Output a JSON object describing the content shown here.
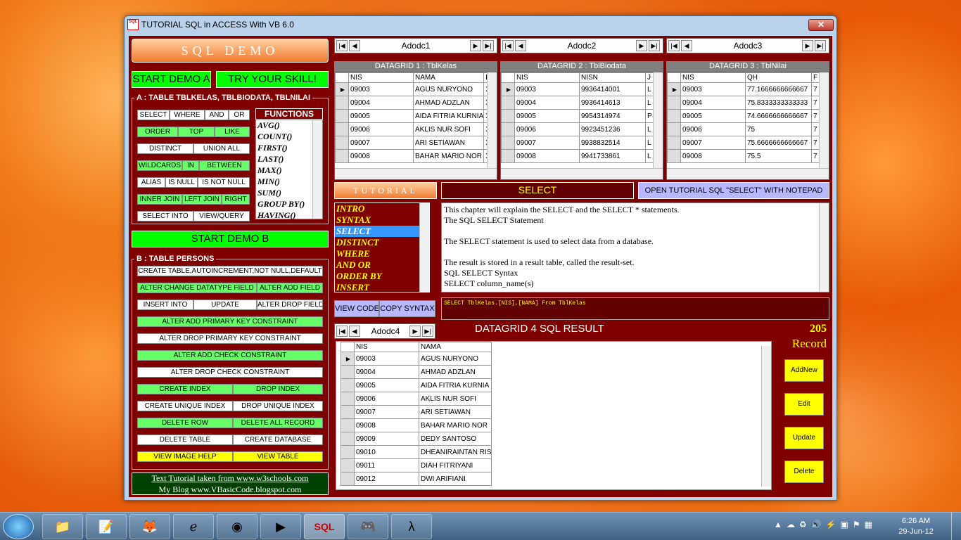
{
  "window": {
    "title": "TUTORIAL SQL in ACCESS With VB 6.0",
    "close": "✕",
    "icon_text": "SQL"
  },
  "left": {
    "banner": "SQL DEMO",
    "start_a": "START DEMO A",
    "try_skill": "TRY YOUR SKILL!",
    "section_a": "A : TABLE TBLKELAS, TBLBIODATA, TBLNILAI",
    "row1": [
      "SELECT",
      "WHERE",
      "AND",
      "OR"
    ],
    "row2": [
      "ORDER",
      "TOP",
      "LIKE"
    ],
    "row3": [
      "DISTINCT",
      "UNION ALL"
    ],
    "row4": [
      "WILDCARDS",
      "IN",
      "BETWEEN"
    ],
    "row5": [
      "ALIAS",
      "IS NULL",
      "IS NOT NULL"
    ],
    "row6": [
      "INNER JOIN",
      "LEFT JOIN",
      "RIGHT"
    ],
    "row7": [
      "SELECT INTO",
      "VIEW/QUERY"
    ],
    "functions_title": "FUNCTIONS",
    "functions": [
      "AVG()",
      "COUNT()",
      "FIRST()",
      "LAST()",
      "MAX()",
      "MIN()",
      "SUM()",
      "GROUP BY()",
      "HAVING()"
    ],
    "start_b": "START DEMO B",
    "section_b": "B : TABLE PERSONS",
    "b1": "CREATE TABLE,AUTOINCREMENT,NOT NULL,DEFAULT",
    "b2": [
      "ALTER CHANGE DATATYPE FIELD",
      "ALTER ADD FIELD"
    ],
    "b3": [
      "INSERT INTO",
      "UPDATE",
      "ALTER DROP FIELD"
    ],
    "b4": "ALTER ADD PRIMARY KEY CONSTRAINT",
    "b5": "ALTER DROP PRIMARY KEY CONSTRAINT",
    "b6": "ALTER ADD CHECK CONSTRAINT",
    "b7": "ALTER DROP CHECK CONSTRAINT",
    "b8": [
      "CREATE INDEX",
      "DROP INDEX"
    ],
    "b9": [
      "CREATE UNIQUE INDEX",
      "DROP UNIQUE INDEX"
    ],
    "b10": [
      "DELETE ROW",
      "DELETE ALL RECORD"
    ],
    "b11": [
      "DELETE TABLE",
      "CREATE DATABASE"
    ],
    "b12": [
      "VIEW IMAGE HELP",
      "VIEW TABLE"
    ],
    "credit1": "Text Tutorial taken from www.w3schools.com",
    "credit2": "My Blog www.VBasicCode.blogspot.com"
  },
  "adodc": {
    "a1": "Adodc1",
    "a2": "Adodc2",
    "a3": "Adodc3",
    "a4": "Adodc4",
    "first": "|◀",
    "prev": "◀",
    "next": "▶",
    "last": "▶|"
  },
  "grid1": {
    "title": "DATAGRID 1 : TblKelas",
    "cols": [
      "NIS",
      "NAMA",
      "K"
    ],
    "rows": [
      [
        "09003",
        "AGUS NURYONO",
        "X"
      ],
      [
        "09004",
        "AHMAD ADZLAN",
        "X"
      ],
      [
        "09005",
        "AIDA FITRIA KURNIA",
        "X"
      ],
      [
        "09006",
        "AKLIS NUR SOFI",
        "X"
      ],
      [
        "09007",
        "ARI SETIAWAN",
        "X"
      ],
      [
        "09008",
        "BAHAR MARIO NOR",
        "X"
      ]
    ]
  },
  "grid2": {
    "title": "DATAGRID 2 : TblBiodata",
    "cols": [
      "NIS",
      "NISN",
      "J"
    ],
    "rows": [
      [
        "09003",
        "9936414001",
        "L"
      ],
      [
        "09004",
        "9936414613",
        "L"
      ],
      [
        "09005",
        "9954314974",
        "P"
      ],
      [
        "09006",
        "9923451236",
        "L"
      ],
      [
        "09007",
        "9938832514",
        "L"
      ],
      [
        "09008",
        "9941733861",
        "L"
      ]
    ]
  },
  "grid3": {
    "title": "DATAGRID 3 : TblNilai",
    "cols": [
      "NIS",
      "QH",
      "F"
    ],
    "rows": [
      [
        "09003",
        "77.1666666666667",
        "7"
      ],
      [
        "09004",
        "75.8333333333333",
        "7"
      ],
      [
        "09005",
        "74.6666666666667",
        "7"
      ],
      [
        "09006",
        "75",
        "7"
      ],
      [
        "09007",
        "75.6666666666667",
        "7"
      ],
      [
        "09008",
        "75.5",
        "7"
      ]
    ]
  },
  "tutorial": {
    "banner": "TUTORIAL",
    "topic": "SELECT",
    "open_btn": "OPEN TUTORIAL SQL \"SELECT\" WITH NOTEPAD",
    "list": [
      "INTRO",
      "SYNTAX",
      "SELECT",
      "DISTINCT",
      "WHERE",
      "AND OR",
      "ORDER BY",
      "INSERT"
    ],
    "text": [
      "This chapter will explain the SELECT and the SELECT * statements.",
      "The SQL SELECT Statement",
      "",
      "The SELECT statement is used to select data from a database.",
      "",
      "The result is stored in a result table, called the result-set.",
      "SQL SELECT Syntax",
      "SELECT column_name(s)"
    ],
    "view_code": "VIEW CODE",
    "copy_syntax": "COPY SYNTAX",
    "sql": "SELECT TblKelas.[NIS],[NAMA] From TblKelas"
  },
  "grid4": {
    "title": "DATAGRID 4 SQL RESULT",
    "count": "205",
    "record": "Record",
    "cols": [
      "NIS",
      "NAMA"
    ],
    "rows": [
      [
        "09003",
        "AGUS NURYONO"
      ],
      [
        "09004",
        "AHMAD ADZLAN"
      ],
      [
        "09005",
        "AIDA FITRIA KURNIA"
      ],
      [
        "09006",
        "AKLIS NUR SOFI"
      ],
      [
        "09007",
        "ARI SETIAWAN"
      ],
      [
        "09008",
        "BAHAR MARIO NOR"
      ],
      [
        "09009",
        "DEDY SANTOSO"
      ],
      [
        "09010",
        "DHEANIRAINTAN RIS"
      ],
      [
        "09011",
        "DIAH FITRIYANI"
      ],
      [
        "09012",
        "DWI ARIFIANI"
      ]
    ]
  },
  "actions": {
    "addnew": "AddNew",
    "edit": "Edit",
    "update": "Update",
    "delete": "Delete"
  },
  "taskbar": {
    "time": "6:26 AM",
    "date": "29-Jun-12",
    "sql_label": "SQL"
  }
}
